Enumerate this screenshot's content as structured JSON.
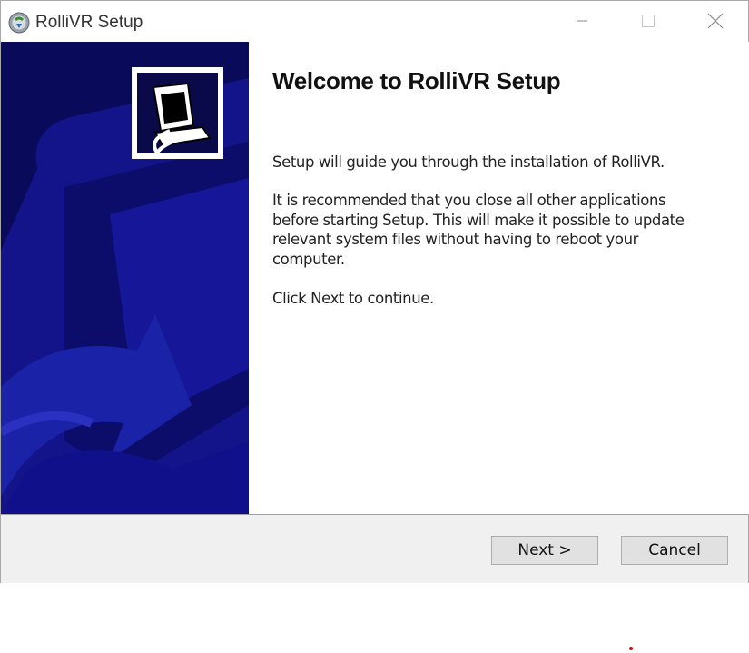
{
  "window": {
    "title": "RolliVR Setup",
    "controls": [
      "minimize-icon",
      "maximize-icon",
      "close-icon"
    ]
  },
  "welcome": {
    "heading": "Welcome to RolliVR Setup",
    "para1": "Setup will guide you through the installation of RolliVR.",
    "para2": "It is recommended that you close all other applications before starting Setup. This will make it possible to update relevant system files without having to reboot your computer.",
    "para3": "Click Next to continue."
  },
  "buttons": {
    "next": "Next >",
    "cancel": "Cancel"
  },
  "colors": {
    "sidebar_bg": "#0a0a5a",
    "sidebar_shape": "#1a22a8",
    "footer_bg": "#f0f0f0"
  }
}
